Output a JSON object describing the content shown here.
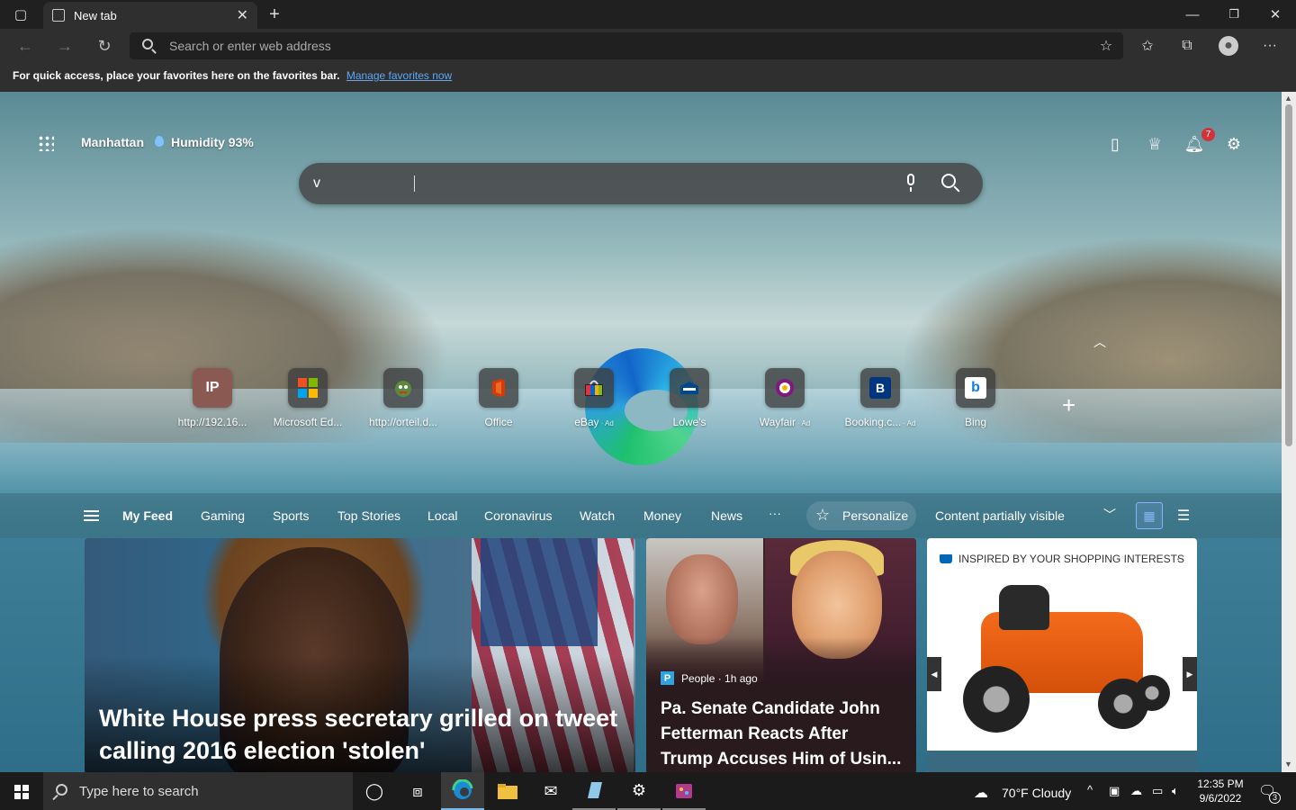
{
  "browser": {
    "tab_title": "New tab",
    "address_placeholder": "Search or enter web address",
    "favorites_notice": "For quick access, place your favorites here on the favorites bar.",
    "favorites_link": "Manage favorites now"
  },
  "ntp": {
    "location": "Manhattan",
    "humidity": "Humidity 93%",
    "notification_count": "7",
    "search_value": "v",
    "top_sites": [
      {
        "label": "http://192.16...",
        "icon": "IP",
        "ad": ""
      },
      {
        "label": "Microsoft Ed...",
        "icon": "ms-logo",
        "ad": ""
      },
      {
        "label": "http://orteil.d...",
        "icon": "cookie-grandma",
        "ad": ""
      },
      {
        "label": "Office",
        "icon": "office-logo",
        "ad": ""
      },
      {
        "label": "eBay",
        "icon": "ebay-bag",
        "ad": "· Ad"
      },
      {
        "label": "Lowe's",
        "icon": "lowes-logo",
        "ad": ""
      },
      {
        "label": "Wayfair",
        "icon": "wayfair-logo",
        "ad": "· Ad"
      },
      {
        "label": "Booking.c...",
        "icon": "B",
        "ad": "· Ad"
      },
      {
        "label": "Bing",
        "icon": "b",
        "ad": ""
      }
    ]
  },
  "feed": {
    "tabs": [
      "My Feed",
      "Gaming",
      "Sports",
      "Top Stories",
      "Local",
      "Coronavirus",
      "Watch",
      "Money",
      "News"
    ],
    "more": "···",
    "personalize": "Personalize",
    "visibility": "Content partially visible",
    "cards": [
      {
        "headline": "White House press secretary grilled on tweet calling 2016 election 'stolen'"
      },
      {
        "source": "People · 1h ago",
        "headline": "Pa. Senate Candidate John Fetterman Reacts After Trump Accuses Him of Usin..."
      },
      {
        "header": "INSPIRED BY YOUR SHOPPING INTERESTS",
        "more": "···"
      }
    ]
  },
  "taskbar": {
    "search_placeholder": "Type here to search",
    "weather": "70°F  Cloudy",
    "time": "12:35 PM",
    "date": "9/6/2022",
    "notifications": "3"
  },
  "colors": {
    "accent": "#5fa8f0",
    "badge": "#d13438"
  }
}
